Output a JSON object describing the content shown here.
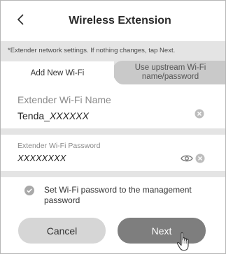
{
  "header": {
    "title": "Wireless Extension",
    "back_icon": "chevron-left-icon"
  },
  "hint": {
    "text": "*Extender network settings. If nothing changes, tap Next."
  },
  "tabs": [
    {
      "label": "Add New Wi-Fi",
      "active": true
    },
    {
      "label": "Use upstream Wi-Fi name/password",
      "active": false
    }
  ],
  "wifi_name": {
    "label": "Extender Wi-Fi Name",
    "prefix": "Tenda_",
    "suffix": "XXXXXX",
    "clear_icon": "clear-icon"
  },
  "wifi_password": {
    "label": "Extender Wi-Fi Password",
    "value": "XXXXXXXX",
    "eye_icon": "eye-icon",
    "clear_icon": "clear-icon"
  },
  "option": {
    "checked": true,
    "label": "Set Wi-Fi password to the management password"
  },
  "buttons": {
    "cancel": "Cancel",
    "next": "Next"
  },
  "colors": {
    "background": "#ffffff",
    "band": "#e4e4e4",
    "inactive_tab": "#c9c9c9",
    "cancel_bg": "#d6d6d6",
    "next_bg": "#7e7e7e",
    "checkbox": "#a9a9a9"
  }
}
